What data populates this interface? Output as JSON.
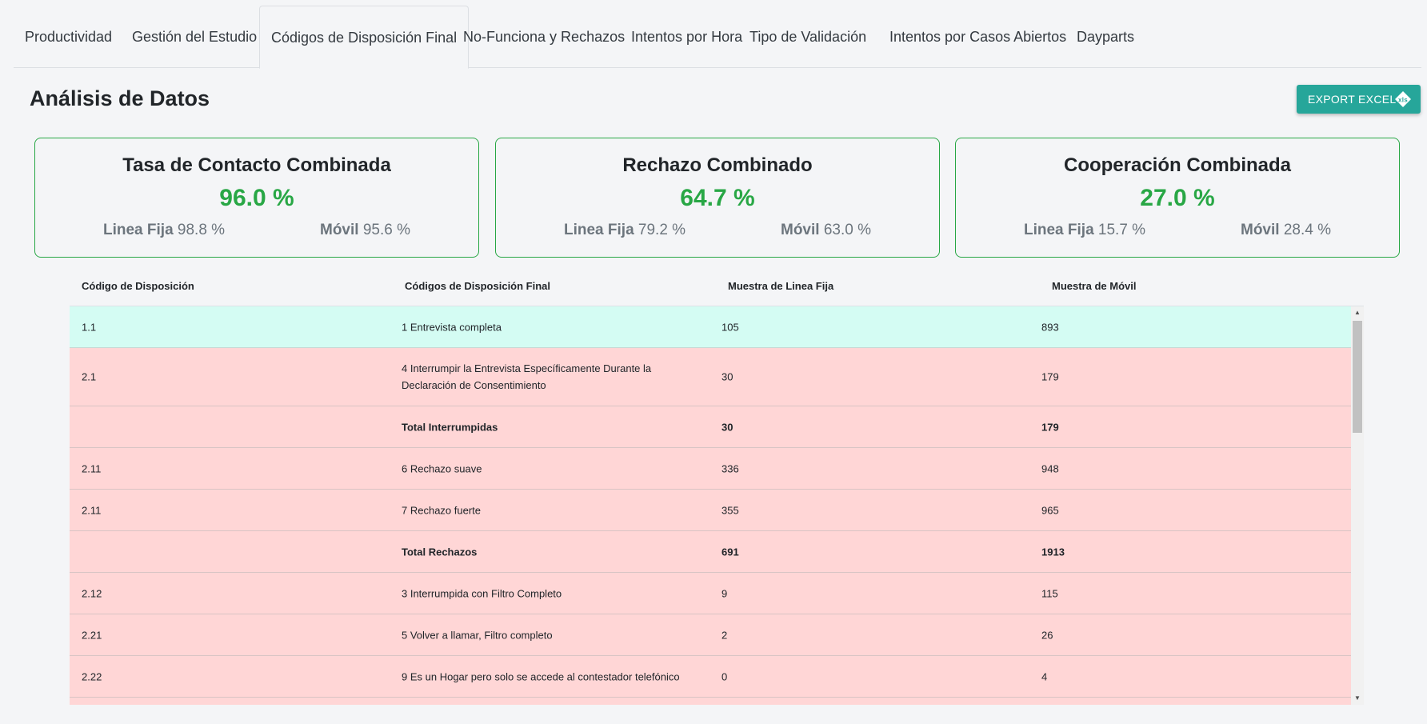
{
  "tabs": [
    {
      "label": "Productividad"
    },
    {
      "label": "Gestión del Estudio"
    },
    {
      "label": "Códigos de Disposición Final"
    },
    {
      "label": "No-Funciona y Rechazos"
    },
    {
      "label": "Intentos por Hora"
    },
    {
      "label": "Tipo de Validación"
    },
    {
      "label": "Intentos por Casos Abiertos"
    },
    {
      "label": "Dayparts"
    }
  ],
  "active_tab": "Códigos de Disposición Final",
  "header": {
    "title": "Análisis de Datos",
    "export_label": "EXPORT EXCEL"
  },
  "cards": [
    {
      "title": "Tasa de Contacto Combinada",
      "value": "96.0 %",
      "fija_label": "Linea Fija",
      "fija_value": "98.8 %",
      "movil_label": "Móvil",
      "movil_value": "95.6 %"
    },
    {
      "title": "Rechazo Combinado",
      "value": "64.7 %",
      "fija_label": "Linea Fija",
      "fija_value": "79.2 %",
      "movil_label": "Móvil",
      "movil_value": "63.0 %"
    },
    {
      "title": "Cooperación Combinada",
      "value": "27.0 %",
      "fija_label": "Linea Fija",
      "fija_value": "15.7 %",
      "movil_label": "Móvil",
      "movil_value": "28.4 %"
    }
  ],
  "table": {
    "headers": [
      "Código de Disposición",
      "Códigos de Disposición Final",
      "Muestra de Linea Fija",
      "Muestra de Móvil"
    ],
    "rows": [
      [
        "1.1",
        "1 Entrevista completa",
        "105",
        "893"
      ],
      [
        "2.1",
        "4 Interrumpir la Entrevista Específicamente Durante la Declaración de Consentimiento",
        "30",
        "179"
      ],
      [
        "",
        "Total Interrumpidas",
        "30",
        "179"
      ],
      [
        "2.11",
        "6 Rechazo suave",
        "336",
        "948"
      ],
      [
        "2.11",
        "7 Rechazo fuerte",
        "355",
        "965"
      ],
      [
        "",
        "Total Rechazos",
        "691",
        "1913"
      ],
      [
        "2.12",
        "3 Interrumpida con Filtro Completo",
        "9",
        "115"
      ],
      [
        "2.21",
        "5 Volver a llamar, Filtro completo",
        "2",
        "26"
      ],
      [
        "2.22",
        "9 Es un Hogar pero solo se accede al contestador telefónico",
        "0",
        "4"
      ]
    ]
  },
  "colors": {
    "accent_green": "#28a745",
    "button_teal": "#26a69a",
    "row_complete": "#d4fcf3",
    "row_other": "#ffd6d6"
  }
}
